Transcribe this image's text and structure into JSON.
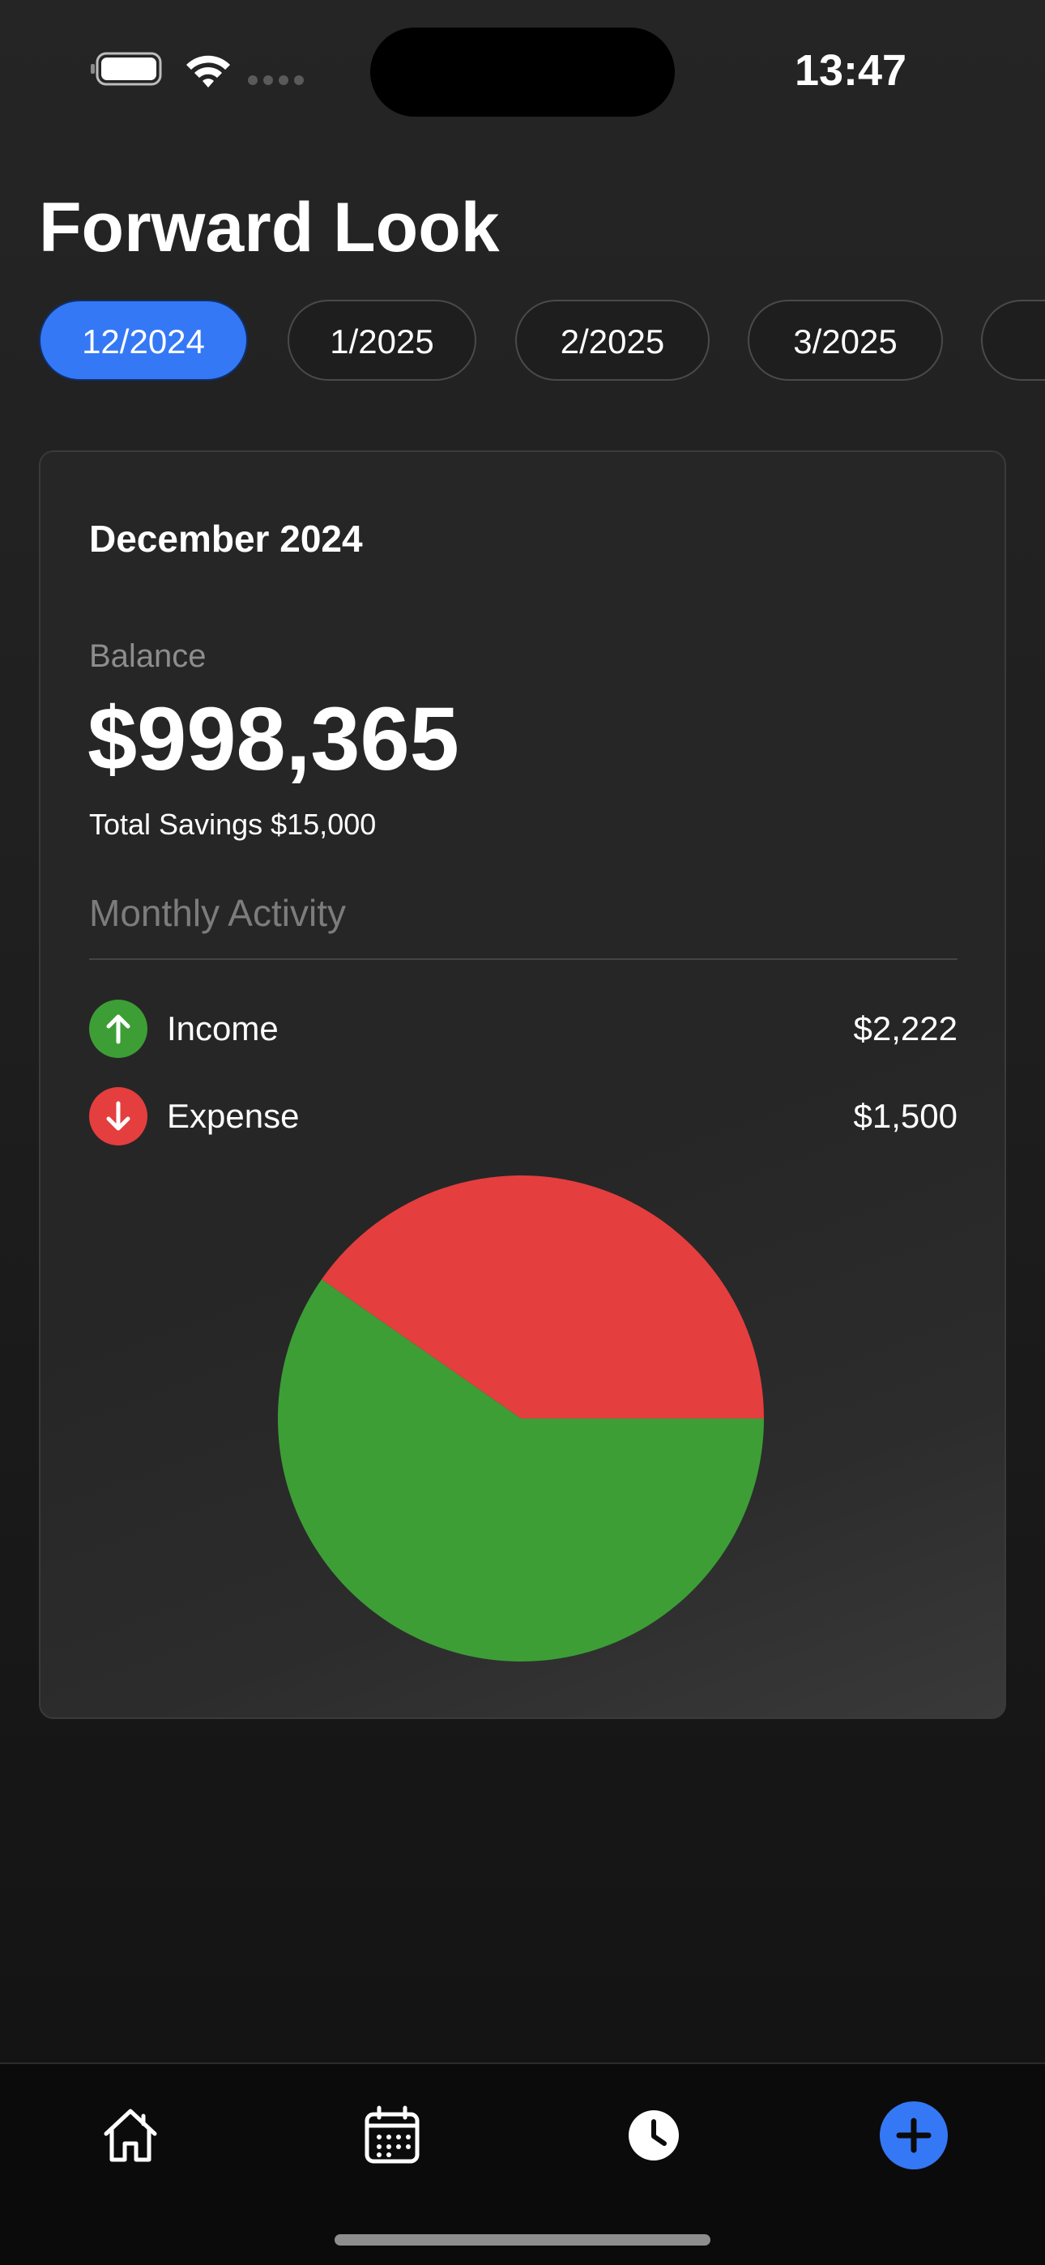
{
  "status_bar": {
    "time": "13:47"
  },
  "header": {
    "title": "Forward Look"
  },
  "months": {
    "selected_index": 0,
    "items": [
      "12/2024",
      "1/2025",
      "2/2025",
      "3/2025",
      ""
    ]
  },
  "card": {
    "month_title": "December 2024",
    "balance_label": "Balance",
    "balance_value": "$998,365",
    "savings_text": "Total Savings $15,000",
    "activity_label": "Monthly Activity",
    "income": {
      "label": "Income",
      "amount": "$2,222",
      "icon": "arrow-up-icon",
      "color": "#3d9e36"
    },
    "expense": {
      "label": "Expense",
      "amount": "$1,500",
      "icon": "arrow-down-icon",
      "color": "#e53e3e"
    }
  },
  "chart_data": {
    "type": "pie",
    "categories": [
      "Income",
      "Expense"
    ],
    "values": [
      2222,
      1500
    ],
    "colors": [
      "#3d9e36",
      "#e53e3e"
    ],
    "title": ""
  },
  "tab_bar": {
    "items": [
      {
        "icon": "home-icon"
      },
      {
        "icon": "calendar-icon"
      },
      {
        "icon": "clock-icon"
      },
      {
        "icon": "plus-icon"
      }
    ],
    "accent": "#3478f6"
  },
  "colors": {
    "accent": "#3478f6",
    "background": "#1f1f1f",
    "card": "#262626",
    "muted_text": "#8d8d8d"
  }
}
